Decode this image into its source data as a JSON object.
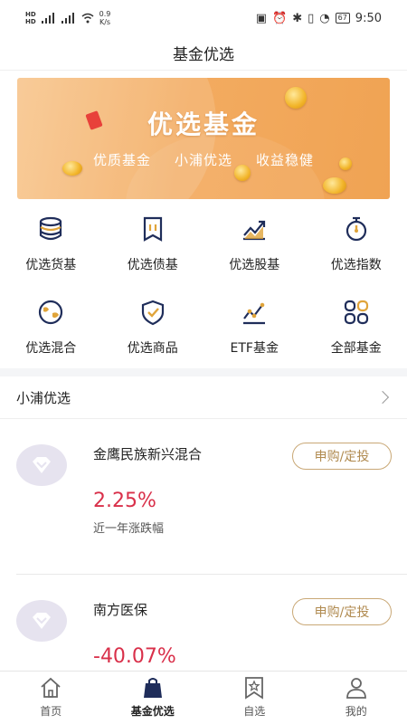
{
  "status_bar": {
    "net_speed_value": "0.9",
    "net_speed_unit": "K/s",
    "signal_left": "HD",
    "battery": "67",
    "time": "9:50"
  },
  "header": {
    "title": "基金优选"
  },
  "banner": {
    "title": "优选基金",
    "subtitles": [
      "优质基金",
      "小浦优选",
      "收益稳健"
    ]
  },
  "categories": [
    {
      "label": "优选货基",
      "icon": "coin-stack-icon"
    },
    {
      "label": "优选债基",
      "icon": "bond-ticket-icon"
    },
    {
      "label": "优选股基",
      "icon": "stock-chart-icon"
    },
    {
      "label": "优选指数",
      "icon": "stopwatch-icon"
    },
    {
      "label": "优选混合",
      "icon": "globe-icon"
    },
    {
      "label": "优选商品",
      "icon": "shield-check-icon"
    },
    {
      "label": "ETF基金",
      "icon": "line-chart-icon"
    },
    {
      "label": "全部基金",
      "icon": "grid-icon"
    }
  ],
  "section": {
    "title": "小浦优选"
  },
  "funds": [
    {
      "name": "金鹰民族新兴混合",
      "button": "申购/定投",
      "rate": "2.25%",
      "rate_label": "近一年涨跌幅"
    },
    {
      "name": "南方医保",
      "button": "申购/定投",
      "rate": "-40.07%",
      "rate_label": ""
    }
  ],
  "tabbar": [
    {
      "label": "首页",
      "icon": "home-icon",
      "active": false
    },
    {
      "label": "基金优选",
      "icon": "bag-icon",
      "active": true
    },
    {
      "label": "自选",
      "icon": "bookmark-star-icon",
      "active": false
    },
    {
      "label": "我的",
      "icon": "user-icon",
      "active": false
    }
  ],
  "colors": {
    "accent_gold": "#c9a876",
    "rate_red": "#d9304a",
    "icon_navy": "#1f2d5a",
    "icon_gold": "#e0a43a"
  }
}
